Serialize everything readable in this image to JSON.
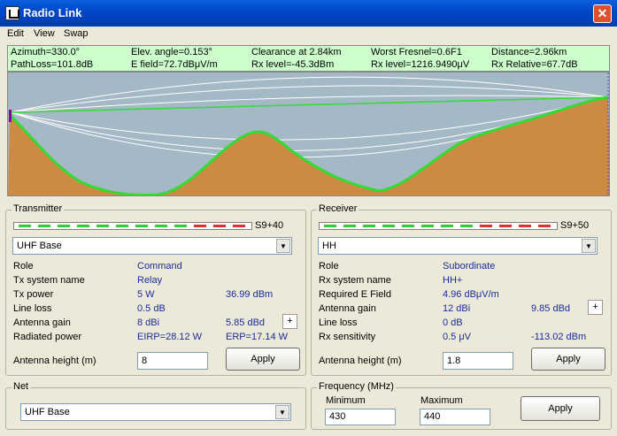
{
  "window": {
    "title": "Radio Link",
    "close_glyph": "✕"
  },
  "menu": [
    "Edit",
    "View",
    "Swap"
  ],
  "info": {
    "row1": [
      "Azimuth=330.0°",
      "Elev. angle=0.153°",
      "Clearance at 2.84km",
      "Worst Fresnel=0.6F1",
      "Distance=2.96km"
    ],
    "row2": [
      "PathLoss=101.8dB",
      "E field=72.7dBμV/m",
      "Rx level=-45.3dBm",
      "Rx level=1216.9490μV",
      "Rx Relative=67.7dB"
    ]
  },
  "colors": {
    "sky": "#a4b8c6",
    "terrain": "#cd8a45",
    "terrain_line": "#32dc32",
    "los": "#32dc32",
    "fresnel": "#ffffff",
    "meter_green": "#32cd32",
    "meter_red": "#e03030",
    "value_text": "#1a2c9c"
  },
  "transmitter": {
    "title": "Transmitter",
    "meter": {
      "label": "S9+40",
      "green_segments": 9,
      "red_segments": 3,
      "total_segments": 12
    },
    "radio": "UHF Base",
    "rows": [
      {
        "label": "Role",
        "value": "Command",
        "value2": ""
      },
      {
        "label": "Tx system name",
        "value": "Relay",
        "value2": ""
      },
      {
        "label": "Tx power",
        "value": "5 W",
        "value2": "36.99 dBm"
      },
      {
        "label": "Line loss",
        "value": "0.5 dB",
        "value2": ""
      },
      {
        "label": "Antenna gain",
        "value": "8 dBi",
        "value2": "5.85 dBd"
      },
      {
        "label": "Radiated power",
        "value": "EIRP=28.12 W",
        "value2": "ERP=17.14 W"
      }
    ],
    "plus": "+",
    "antenna_height_label": "Antenna height (m)",
    "antenna_height": "8",
    "apply": "Apply"
  },
  "receiver": {
    "title": "Receiver",
    "meter": {
      "label": "S9+50",
      "green_segments": 8,
      "red_segments": 4,
      "total_segments": 12
    },
    "radio": "HH",
    "rows": [
      {
        "label": "Role",
        "value": "Subordinate",
        "value2": ""
      },
      {
        "label": "Rx system name",
        "value": "HH+",
        "value2": ""
      },
      {
        "label": "Required E Field",
        "value": "4.96 dBμV/m",
        "value2": ""
      },
      {
        "label": "Antenna gain",
        "value": "12 dBi",
        "value2": "9.85 dBd"
      },
      {
        "label": "Line loss",
        "value": "0 dB",
        "value2": ""
      },
      {
        "label": "Rx sensitivity",
        "value": "0.5 μV",
        "value2": "-113.02 dBm"
      }
    ],
    "plus": "+",
    "antenna_height_label": "Antenna height (m)",
    "antenna_height": "1.8",
    "apply": "Apply"
  },
  "net": {
    "title": "Net",
    "selected": "UHF Base"
  },
  "frequency": {
    "title": "Frequency (MHz)",
    "min_label": "Minimum",
    "min": "430",
    "max_label": "Maximum",
    "max": "440",
    "apply": "Apply"
  }
}
